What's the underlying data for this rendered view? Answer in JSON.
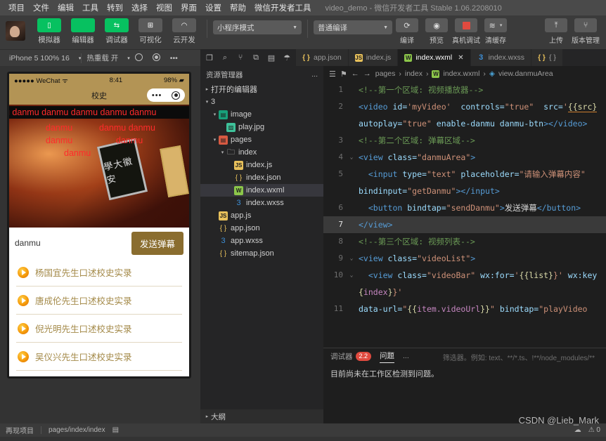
{
  "titlebar": {
    "menus": [
      "项目",
      "文件",
      "编辑",
      "工具",
      "转到",
      "选择",
      "视图",
      "界面",
      "设置",
      "帮助",
      "微信开发者工具"
    ],
    "title": "video_demo - 微信开发者工具 Stable 1.06.2208010"
  },
  "toolbar": {
    "buttons": [
      {
        "label": "模拟器",
        "icon": "phone-icon",
        "style": "green"
      },
      {
        "label": "编辑器",
        "icon": "code-icon",
        "style": "green"
      },
      {
        "label": "调试器",
        "icon": "debug-icon",
        "style": "green"
      },
      {
        "label": "可视化",
        "icon": "layout-icon",
        "style": "grey"
      },
      {
        "label": "云开发",
        "icon": "cloud-icon",
        "style": "grey"
      }
    ],
    "mode_select": "小程序模式",
    "compile_select": "普通编译",
    "actions": [
      {
        "label": "编译",
        "icon": "refresh-icon"
      },
      {
        "label": "预览",
        "icon": "eye-icon"
      },
      {
        "label": "真机调试",
        "icon": "device-icon"
      },
      {
        "label": "清缓存",
        "icon": "stack-icon"
      }
    ],
    "right_actions": [
      {
        "label": "上传",
        "icon": "upload-icon"
      },
      {
        "label": "版本管理",
        "icon": "branch-icon"
      }
    ]
  },
  "devicebar": {
    "device": "iPhone 5 100% 16",
    "heat": "热重载 开",
    "icons": [
      "refresh-circle-icon",
      "record-icon",
      "more-icon"
    ]
  },
  "tabs": {
    "icons": [
      "copy-icon",
      "search-icon",
      "branch-icon",
      "extensions-icon",
      "save-icon",
      "debug-icon"
    ],
    "items": [
      {
        "label": "app.json",
        "type": "json",
        "active": false,
        "closeable": false
      },
      {
        "label": "index.js",
        "type": "js",
        "active": false,
        "closeable": false
      },
      {
        "label": "index.wxml",
        "type": "wxml",
        "active": true,
        "closeable": true
      },
      {
        "label": "index.wxss",
        "type": "wxss",
        "active": false,
        "closeable": false
      },
      {
        "label": "{ }",
        "type": "json",
        "active": false,
        "closeable": false
      }
    ]
  },
  "simulator": {
    "status": {
      "carrier": "WeChat",
      "time": "8:41",
      "battery": "98%"
    },
    "nav_title": "校史",
    "danmu_overlay": [
      "u  danmu  danmu   danmu   danmu   danmu",
      "danmu",
      "danmu  danmu",
      "danmu",
      "danmu",
      "danmu"
    ],
    "video_text": "學大徽安",
    "input_value": "danmu",
    "send_label": "发送弹幕",
    "videos": [
      "杨国宜先生口述校史实录",
      "唐成伦先生口述校史实录",
      "倪光明先生口述校史实录",
      "吴仪兴先生口述校史实录"
    ]
  },
  "explorer": {
    "title": "资源管理器",
    "more": "...",
    "sections": [
      {
        "label": "打开的编辑器",
        "depth": 0,
        "arrow": "▸",
        "icon": null
      },
      {
        "label": "3",
        "depth": 0,
        "arrow": "▾",
        "icon": null
      },
      {
        "label": "image",
        "depth": 1,
        "arrow": "▾",
        "icon": "folder-img"
      },
      {
        "label": "play.jpg",
        "depth": 2,
        "arrow": "",
        "icon": "img"
      },
      {
        "label": "pages",
        "depth": 1,
        "arrow": "▾",
        "icon": "folder-pages"
      },
      {
        "label": "index",
        "depth": 2,
        "arrow": "▾",
        "icon": "folder-plain"
      },
      {
        "label": "index.js",
        "depth": 3,
        "arrow": "",
        "icon": "js"
      },
      {
        "label": "index.json",
        "depth": 3,
        "arrow": "",
        "icon": "json"
      },
      {
        "label": "index.wxml",
        "depth": 3,
        "arrow": "",
        "icon": "wxml",
        "selected": true
      },
      {
        "label": "index.wxss",
        "depth": 3,
        "arrow": "",
        "icon": "wxss"
      },
      {
        "label": "app.js",
        "depth": 1,
        "arrow": "",
        "icon": "js"
      },
      {
        "label": "app.json",
        "depth": 1,
        "arrow": "",
        "icon": "json"
      },
      {
        "label": "app.wxss",
        "depth": 1,
        "arrow": "",
        "icon": "wxss"
      },
      {
        "label": "sitemap.json",
        "depth": 1,
        "arrow": "",
        "icon": "json"
      }
    ],
    "outline": "大纲"
  },
  "breadcrumb": {
    "parts": [
      "pages",
      "index",
      "index.wxml",
      "view.danmuArea"
    ]
  },
  "code": {
    "lines": [
      {
        "num": "1",
        "fold": "",
        "active": false,
        "tokens": [
          {
            "t": "<!--第一个区域: 视频播放器-->",
            "c": "k-com"
          }
        ]
      },
      {
        "num": "2",
        "fold": "",
        "active": false,
        "tokens": [
          {
            "t": "<video ",
            "c": "k-tag"
          },
          {
            "t": "id=",
            "c": "k-attr"
          },
          {
            "t": "'myVideo'",
            "c": "k-str"
          },
          {
            "t": "  controls=",
            "c": "k-attr"
          },
          {
            "t": "\"true\"",
            "c": "k-str"
          },
          {
            "t": "  src=",
            "c": "k-attr"
          },
          {
            "t": "'",
            "c": "k-str"
          },
          {
            "t": "{{src}",
            "c": "k-src"
          }
        ]
      },
      {
        "num": "",
        "fold": "",
        "active": false,
        "tokens": [
          {
            "t": "autoplay=",
            "c": "k-attr"
          },
          {
            "t": "\"true\"",
            "c": "k-str"
          },
          {
            "t": " enable-danmu danmu-btn",
            "c": "k-attr"
          },
          {
            "t": "></video>",
            "c": "k-tag"
          }
        ]
      },
      {
        "num": "3",
        "fold": "",
        "active": false,
        "tokens": [
          {
            "t": "<!--第二个区域: 弹幕区域-->",
            "c": "k-com"
          }
        ]
      },
      {
        "num": "4",
        "fold": "⌄",
        "active": false,
        "tokens": [
          {
            "t": "<view ",
            "c": "k-tag"
          },
          {
            "t": "class=",
            "c": "k-attr"
          },
          {
            "t": "\"danmuArea\"",
            "c": "k-str"
          },
          {
            "t": ">",
            "c": "k-tag"
          }
        ]
      },
      {
        "num": "5",
        "fold": "",
        "active": false,
        "tokens": [
          {
            "t": "  <input ",
            "c": "k-tag"
          },
          {
            "t": "type=",
            "c": "k-attr"
          },
          {
            "t": "\"text\"",
            "c": "k-str"
          },
          {
            "t": " placeholder=",
            "c": "k-attr"
          },
          {
            "t": "\"请输入弹幕内容\"",
            "c": "k-str"
          }
        ]
      },
      {
        "num": "",
        "fold": "",
        "active": false,
        "tokens": [
          {
            "t": "bindinput=",
            "c": "k-attr"
          },
          {
            "t": "\"getDanmu\"",
            "c": "k-str"
          },
          {
            "t": "></input>",
            "c": "k-tag"
          }
        ]
      },
      {
        "num": "6",
        "fold": "",
        "active": false,
        "tokens": [
          {
            "t": "  <button ",
            "c": "k-tag"
          },
          {
            "t": "bindtap=",
            "c": "k-attr"
          },
          {
            "t": "\"sendDanmu\"",
            "c": "k-str"
          },
          {
            "t": ">",
            "c": "k-tag"
          },
          {
            "t": "发送弹幕",
            "c": "k-txt"
          },
          {
            "t": "</button>",
            "c": "k-tag"
          }
        ]
      },
      {
        "num": "7",
        "fold": "",
        "active": true,
        "tokens": [
          {
            "t": "</view>",
            "c": "k-tag"
          }
        ]
      },
      {
        "num": "8",
        "fold": "",
        "active": false,
        "tokens": [
          {
            "t": "<!--第三个区域: 视频列表-->",
            "c": "k-com"
          }
        ]
      },
      {
        "num": "9",
        "fold": "⌄",
        "active": false,
        "tokens": [
          {
            "t": "<view ",
            "c": "k-tag"
          },
          {
            "t": "class=",
            "c": "k-attr"
          },
          {
            "t": "\"videoList\"",
            "c": "k-str"
          },
          {
            "t": ">",
            "c": "k-tag"
          }
        ]
      },
      {
        "num": "10",
        "fold": "⌄",
        "active": false,
        "tokens": [
          {
            "t": "  <view ",
            "c": "k-tag"
          },
          {
            "t": "class=",
            "c": "k-attr"
          },
          {
            "t": "\"videoBar\"",
            "c": "k-str"
          },
          {
            "t": " wx:for=",
            "c": "k-attr"
          },
          {
            "t": "'",
            "c": "k-str"
          },
          {
            "t": "{{list}",
            "c": "k-mus"
          },
          {
            "t": "}'",
            "c": "k-str"
          },
          {
            "t": " wx:key",
            "c": "k-attr"
          }
        ]
      },
      {
        "num": "",
        "fold": "",
        "active": false,
        "tokens": [
          {
            "t": "{",
            "c": "k-mus"
          },
          {
            "t": "index",
            "c": "k-var"
          },
          {
            "t": "}",
            "c": "k-mus"
          },
          {
            "t": "}'",
            "c": "k-str"
          }
        ]
      },
      {
        "num": "11",
        "fold": "",
        "active": false,
        "tokens": [
          {
            "t": "data-url=",
            "c": "k-attr"
          },
          {
            "t": "\"",
            "c": "k-str"
          },
          {
            "t": "{{",
            "c": "k-mus"
          },
          {
            "t": "item.videoUrl",
            "c": "k-var"
          },
          {
            "t": "}}",
            "c": "k-mus"
          },
          {
            "t": "\"",
            "c": "k-str"
          },
          {
            "t": " bindtap=",
            "c": "k-attr"
          },
          {
            "t": "\"playVideo",
            "c": "k-str"
          }
        ]
      }
    ]
  },
  "panel": {
    "tabs": [
      {
        "label": "调试器",
        "badge": "2.2",
        "active": false
      },
      {
        "label": "问题",
        "badge": null,
        "active": true
      },
      {
        "label": "...",
        "badge": null,
        "active": false
      }
    ],
    "filter_placeholder": "筛选器。例如: text、**/*.ts、!**/node_modules/**",
    "message": "目前尚未在工作区检测到问题。"
  },
  "statusbar": {
    "left": "再现项目",
    "path": "pages/index/index",
    "icons": [
      "save-icon",
      "bell-icon",
      "warn-icon"
    ]
  },
  "watermark": "CSDN @Lieb_Mark",
  "colors": {
    "accent_green": "#07c160",
    "editor_bg": "#1e1e1e",
    "panel_bg": "#252526",
    "chrome_bg": "#3b3b3b",
    "danmu_red": "#ff2b2b",
    "theme_gold": "#b39455"
  }
}
